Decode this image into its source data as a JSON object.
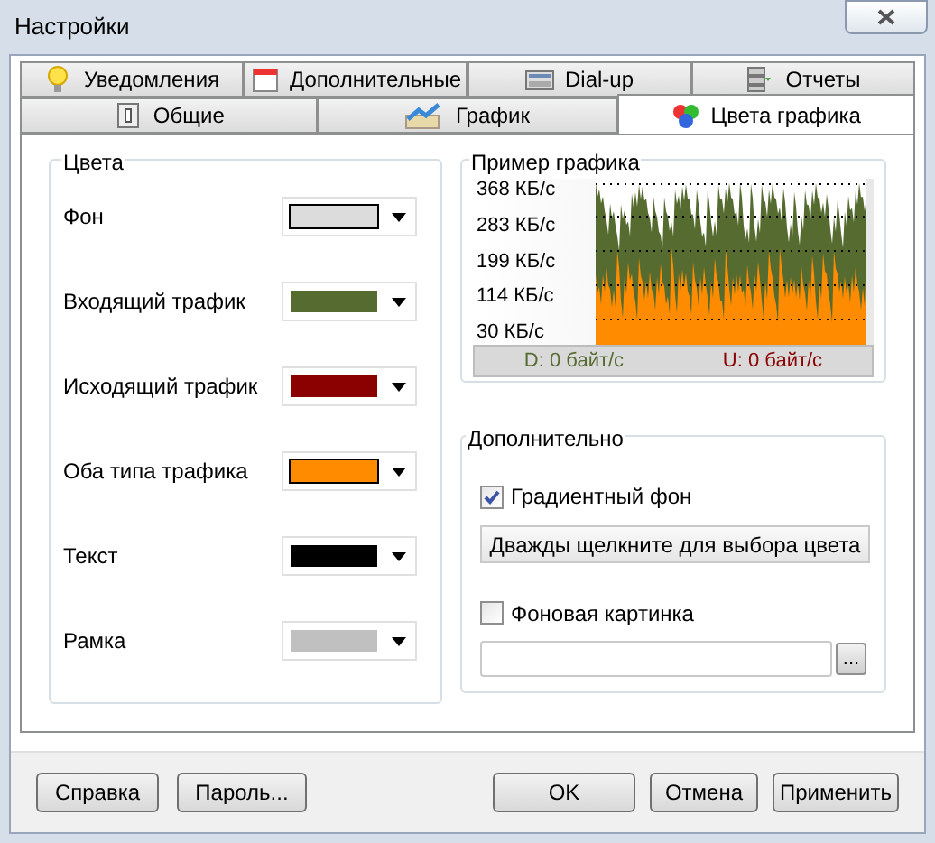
{
  "window": {
    "title": "Настройки"
  },
  "tab_rows": [
    [
      {
        "label": "Уведомления",
        "selected": false
      },
      {
        "label": "Дополнительные",
        "selected": false
      },
      {
        "label": "Dial-up",
        "selected": false
      },
      {
        "label": "Отчеты",
        "selected": false
      }
    ],
    [
      {
        "label": "Общие",
        "selected": false
      },
      {
        "label": "График",
        "selected": false
      },
      {
        "label": "Цвета графика",
        "selected": true
      }
    ]
  ],
  "colors_group": {
    "title": "Цвета",
    "items": [
      {
        "label": "Фон",
        "color": "#dcdcdc",
        "outlined": true
      },
      {
        "label": "Входящий трафик",
        "color": "#556b2f",
        "outlined": false
      },
      {
        "label": "Исходящий трафик",
        "color": "#8b0000",
        "outlined": false
      },
      {
        "label": "Оба типа трафика",
        "color": "#ff8c00",
        "outlined": true
      },
      {
        "label": "Текст",
        "color": "#000000",
        "outlined": false
      },
      {
        "label": "Рамка",
        "color": "#c0c0c0",
        "outlined": false
      }
    ]
  },
  "preview_group": {
    "title": "Пример графика",
    "y_labels": [
      "368 КБ/с",
      "283 КБ/с",
      "199 КБ/с",
      "114 КБ/с",
      "30 КБ/с"
    ],
    "download": "D: 0 байт/с",
    "upload": "U: 0 байт/с"
  },
  "extra_group": {
    "title": "Дополнительно",
    "gradient": {
      "label": "Градиентный фон",
      "checked": true
    },
    "pick_button": "Дважды щелкните для выбора цвета",
    "background_image": {
      "label": "Фоновая картинка",
      "checked": false
    },
    "browse_button": "..."
  },
  "buttons_left": [
    "Справка",
    "Пароль..."
  ],
  "buttons_right": [
    "OK",
    "Отмена",
    "Применить"
  ]
}
